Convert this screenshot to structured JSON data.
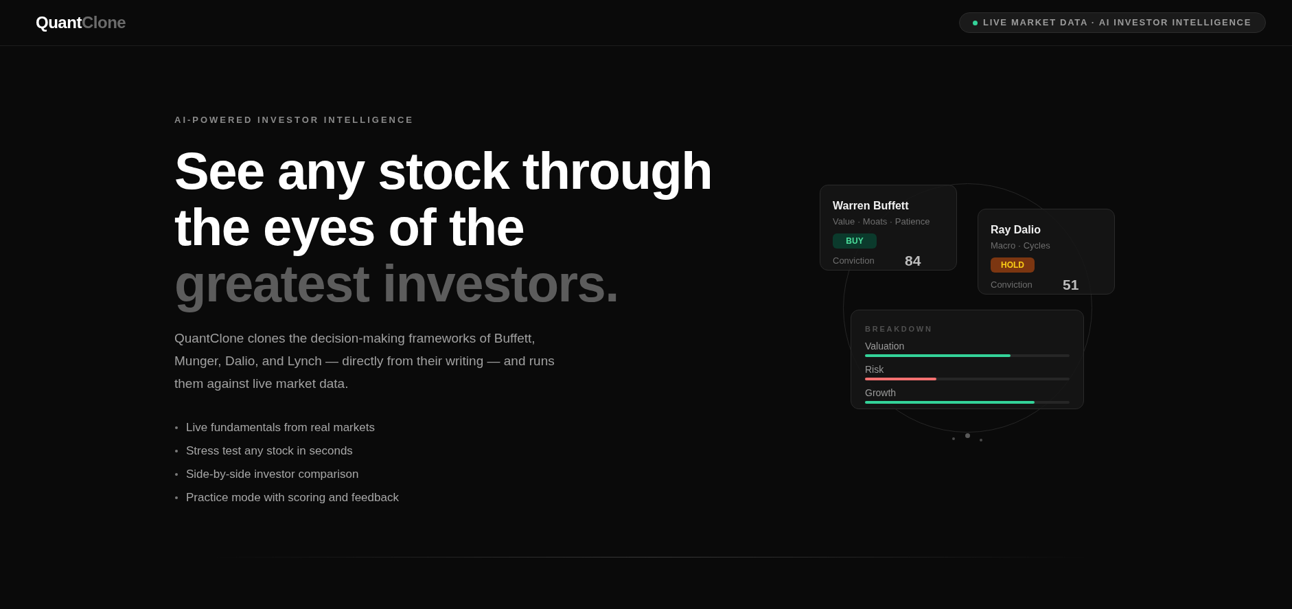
{
  "header": {
    "logo": {
      "primary": "Quant",
      "secondary": "Clone"
    },
    "status_badge": {
      "label": "LIVE MARKET DATA · AI INVESTOR INTELLIGENCE"
    }
  },
  "hero": {
    "eyebrow": "AI-POWERED INVESTOR INTELLIGENCE",
    "headline": {
      "main": "See any stock through the eyes of the",
      "accent": "greatest investors."
    },
    "description": "QuantClone clones the decision-making frameworks of Buffett, Munger, Dalio, and Lynch — directly from their writing — and runs them against live market data.",
    "features": [
      "Live fundamentals from real markets",
      "Stress test any stock in seconds",
      "Side-by-side investor comparison",
      "Practice mode with scoring and feedback"
    ]
  },
  "investor_cards": [
    {
      "name": "Warren Buffett",
      "traits": "Value · Moats · Patience",
      "signal": {
        "label": "BUY",
        "kind": "buy"
      },
      "conviction_label": "Conviction",
      "conviction": "84"
    },
    {
      "name": "Ray Dalio",
      "traits": "Macro · Cycles",
      "signal": {
        "label": "HOLD",
        "kind": "hold"
      },
      "conviction_label": "Conviction",
      "conviction": "51"
    }
  ],
  "breakdown": {
    "title": "BREAKDOWN",
    "metrics": [
      {
        "label": "Valuation",
        "level": 0.71,
        "color": "#34d399"
      },
      {
        "label": "Risk",
        "level": 0.35,
        "color": "#f87171"
      },
      {
        "label": "Growth",
        "level": 0.83,
        "color": "#34d399"
      }
    ]
  }
}
